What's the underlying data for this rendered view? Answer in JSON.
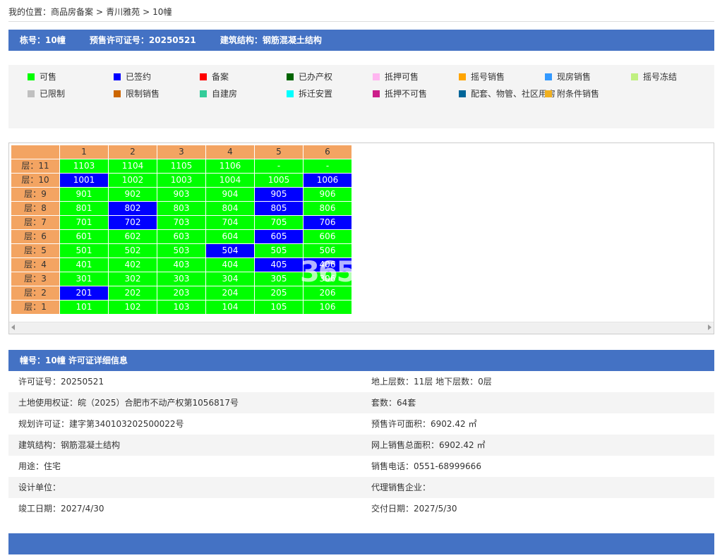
{
  "breadcrumb": {
    "prefix": "我的位置：",
    "items": [
      "商品房备案",
      "青川雅苑",
      "10幢"
    ],
    "separator": ">"
  },
  "building_header": {
    "building_no": "栋号：10幢",
    "presale_permit": "预售许可证号：20250521",
    "structure": "建筑结构：钢筋混凝土结构"
  },
  "legend": [
    {
      "label": "可售",
      "color": "#00ff00"
    },
    {
      "label": "已签约",
      "color": "#0000ff"
    },
    {
      "label": "备案",
      "color": "#ff0000"
    },
    {
      "label": "已办产权",
      "color": "#006400"
    },
    {
      "label": "抵押可售",
      "color": "#ffb6f0"
    },
    {
      "label": "摇号销售",
      "color": "#ffa500"
    },
    {
      "label": "现房销售",
      "color": "#3399ff"
    },
    {
      "label": "摇号冻结",
      "color": "#c0f080"
    },
    {
      "label": "已限制",
      "color": "#c0c0c0"
    },
    {
      "label": "限制销售",
      "color": "#cc6600"
    },
    {
      "label": "自建房",
      "color": "#33cc99"
    },
    {
      "label": "拆迁安置",
      "color": "#00ffff"
    },
    {
      "label": "抵押不可售",
      "color": "#cc1f8a"
    },
    {
      "label": "配套、物管、社区用房",
      "color": "#006699"
    },
    {
      "label": "附条件销售",
      "color": "#f0b020"
    }
  ],
  "units": {
    "columns": [
      "1",
      "2",
      "3",
      "4",
      "5",
      "6"
    ],
    "floor_prefix": "层：",
    "floors": [
      {
        "floor": "11",
        "cells": [
          {
            "no": "1103",
            "s": 0
          },
          {
            "no": "1104",
            "s": 0
          },
          {
            "no": "1105",
            "s": 0
          },
          {
            "no": "1106",
            "s": 0
          },
          {
            "no": "-",
            "s": 0
          },
          {
            "no": "-",
            "s": 0
          }
        ]
      },
      {
        "floor": "10",
        "cells": [
          {
            "no": "1001",
            "s": 1
          },
          {
            "no": "1002",
            "s": 0
          },
          {
            "no": "1003",
            "s": 0
          },
          {
            "no": "1004",
            "s": 0
          },
          {
            "no": "1005",
            "s": 0
          },
          {
            "no": "1006",
            "s": 1
          }
        ]
      },
      {
        "floor": "9",
        "cells": [
          {
            "no": "901",
            "s": 0
          },
          {
            "no": "902",
            "s": 0
          },
          {
            "no": "903",
            "s": 0
          },
          {
            "no": "904",
            "s": 0
          },
          {
            "no": "905",
            "s": 1
          },
          {
            "no": "906",
            "s": 0
          }
        ]
      },
      {
        "floor": "8",
        "cells": [
          {
            "no": "801",
            "s": 0
          },
          {
            "no": "802",
            "s": 1
          },
          {
            "no": "803",
            "s": 0
          },
          {
            "no": "804",
            "s": 0
          },
          {
            "no": "805",
            "s": 1
          },
          {
            "no": "806",
            "s": 0
          }
        ]
      },
      {
        "floor": "7",
        "cells": [
          {
            "no": "701",
            "s": 0
          },
          {
            "no": "702",
            "s": 1
          },
          {
            "no": "703",
            "s": 0
          },
          {
            "no": "704",
            "s": 0
          },
          {
            "no": "705",
            "s": 0
          },
          {
            "no": "706",
            "s": 1
          }
        ]
      },
      {
        "floor": "6",
        "cells": [
          {
            "no": "601",
            "s": 0
          },
          {
            "no": "602",
            "s": 0
          },
          {
            "no": "603",
            "s": 0
          },
          {
            "no": "604",
            "s": 0
          },
          {
            "no": "605",
            "s": 1
          },
          {
            "no": "606",
            "s": 0
          }
        ]
      },
      {
        "floor": "5",
        "cells": [
          {
            "no": "501",
            "s": 0
          },
          {
            "no": "502",
            "s": 0
          },
          {
            "no": "503",
            "s": 0
          },
          {
            "no": "504",
            "s": 1
          },
          {
            "no": "505",
            "s": 0
          },
          {
            "no": "506",
            "s": 0
          }
        ]
      },
      {
        "floor": "4",
        "cells": [
          {
            "no": "401",
            "s": 0
          },
          {
            "no": "402",
            "s": 0
          },
          {
            "no": "403",
            "s": 0
          },
          {
            "no": "404",
            "s": 0
          },
          {
            "no": "405",
            "s": 1
          },
          {
            "no": "406",
            "s": 1
          }
        ]
      },
      {
        "floor": "3",
        "cells": [
          {
            "no": "301",
            "s": 0
          },
          {
            "no": "302",
            "s": 0
          },
          {
            "no": "303",
            "s": 0
          },
          {
            "no": "304",
            "s": 0
          },
          {
            "no": "305",
            "s": 0
          },
          {
            "no": "306",
            "s": 0
          }
        ]
      },
      {
        "floor": "2",
        "cells": [
          {
            "no": "201",
            "s": 1
          },
          {
            "no": "202",
            "s": 0
          },
          {
            "no": "203",
            "s": 0
          },
          {
            "no": "204",
            "s": 0
          },
          {
            "no": "205",
            "s": 0
          },
          {
            "no": "206",
            "s": 0
          }
        ]
      },
      {
        "floor": "1",
        "cells": [
          {
            "no": "101",
            "s": 0
          },
          {
            "no": "102",
            "s": 0
          },
          {
            "no": "103",
            "s": 0
          },
          {
            "no": "104",
            "s": 0
          },
          {
            "no": "105",
            "s": 0
          },
          {
            "no": "106",
            "s": 0
          }
        ]
      }
    ]
  },
  "watermark": "365",
  "detail_header": "幢号：10幢 许可证详细信息",
  "details": [
    {
      "left": "许可证号：20250521",
      "right": "地上层数：11层  地下层数：0层"
    },
    {
      "left": "土地使用权证：皖（2025）合肥市不动产权第1056817号",
      "right": "套数：64套"
    },
    {
      "left": "规划许可证：建字第340103202500022号",
      "right": "预售许可面积：6902.42 ㎡"
    },
    {
      "left": "建筑结构：钢筋混凝土结构",
      "right": "网上销售总面积：6902.42 ㎡"
    },
    {
      "left": "用途：住宅",
      "right": "销售电话：0551-68999666"
    },
    {
      "left": "设计单位：",
      "right": "代理销售企业："
    },
    {
      "left": "竣工日期：2027/4/30",
      "right": "交付日期：2027/5/30"
    }
  ]
}
